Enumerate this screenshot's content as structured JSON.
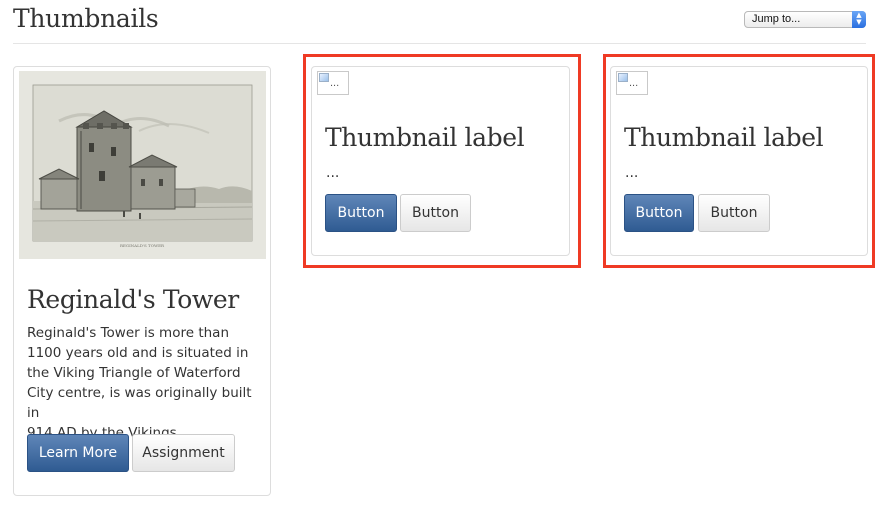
{
  "header": {
    "title": "Thumbnails",
    "jump_select": {
      "selected": "Jump to..."
    }
  },
  "thumbnails": [
    {
      "title": "Reginald's Tower",
      "body_lines": [
        "Reginald's Tower is more than",
        "1100 years old and is situated in",
        "the Viking Triangle of Waterford",
        "City centre, is was originally built in",
        "914 AD by the Vikings"
      ],
      "primary_button": "Learn More",
      "secondary_button": "Assignment",
      "image_caption": "REGINALD'S TOWER"
    },
    {
      "image_alt": "...",
      "title": "Thumbnail label",
      "body": "...",
      "primary_button": "Button",
      "secondary_button": "Button"
    },
    {
      "image_alt": "...",
      "title": "Thumbnail label",
      "body": "...",
      "primary_button": "Button",
      "secondary_button": "Button"
    }
  ],
  "highlight_color": "#ef3a24",
  "primary_color": "#3b6aa0"
}
